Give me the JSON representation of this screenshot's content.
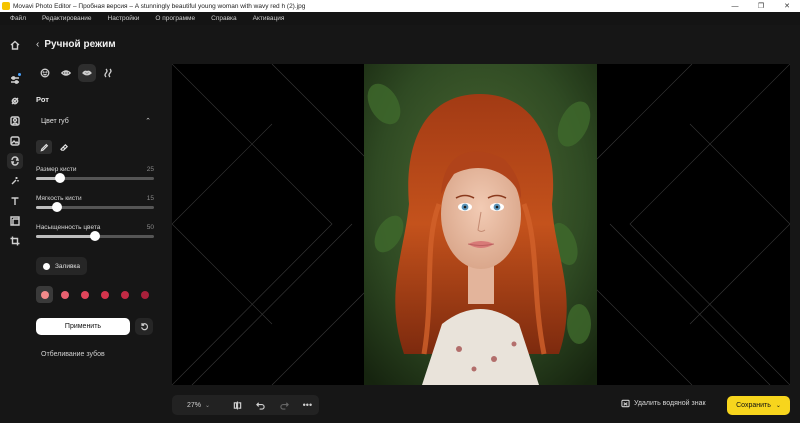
{
  "window": {
    "title": "Movavi Photo Editor – Пробная версия – A stunningly beautiful young woman with wavy red h (2).jpg",
    "controls": [
      "—",
      "❐",
      "✕"
    ]
  },
  "menu": [
    "Файл",
    "Редактирование",
    "Настройки",
    "О программе",
    "Справка",
    "Активация"
  ],
  "rail_icons": [
    "home-icon",
    "adjust-icon",
    "retouch-icon",
    "portrait-icon",
    "replace-bg-icon",
    "manual-mode-icon",
    "magic-icon",
    "text-icon",
    "frame-icon",
    "crop-icon"
  ],
  "panel": {
    "title": "Ручной режим",
    "mode_tabs": [
      "face-tab",
      "eye-tab",
      "mouth-tab",
      "hair-tab"
    ],
    "section": "Рот",
    "subsection": "Цвет губ",
    "sliders": [
      {
        "label": "Размер кисти",
        "value": "25",
        "fraction": 0.2
      },
      {
        "label": "Мягкость кисти",
        "value": "15",
        "fraction": 0.18
      },
      {
        "label": "Насыщенность цвета",
        "value": "50",
        "fraction": 0.5
      }
    ],
    "fill_label": "Заливка",
    "swatches": [
      "#f28a8a",
      "#e8606f",
      "#e0455a",
      "#d4344c",
      "#c12a44",
      "#a8203a"
    ],
    "apply_label": "Применить",
    "teeth_label": "Отбеливание зубов"
  },
  "bottom": {
    "zoom": "27%",
    "remove_watermark": "Удалить водяной знак",
    "save": "Сохранить"
  },
  "colors": {
    "accent": "#f7d51d",
    "background": "#161616",
    "canvas": "#000000"
  }
}
